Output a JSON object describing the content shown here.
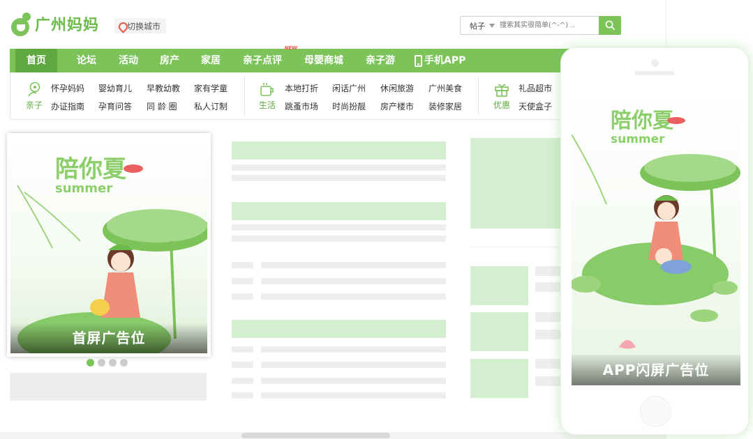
{
  "header": {
    "logo_text": "广州妈妈",
    "city_switch": "切换城市",
    "search_type": "帖子",
    "search_placeholder": "搜索其实很简单(^-^) .."
  },
  "nav": {
    "items": [
      {
        "label": "首页",
        "active": true
      },
      {
        "label": "论坛"
      },
      {
        "label": "活动"
      },
      {
        "label": "房产"
      },
      {
        "label": "家居"
      },
      {
        "label": "亲子点评",
        "badge": "NEW"
      },
      {
        "label": "母婴商城"
      },
      {
        "label": "亲子游"
      },
      {
        "label": "手机APP",
        "icon": "phone-icon"
      }
    ]
  },
  "subnav": {
    "groups": [
      {
        "category": "亲子",
        "icon": "baby-icon",
        "links": [
          "怀孕妈妈",
          "婴幼育儿",
          "早教幼教",
          "家有学童",
          "办证指南",
          "孕育问答",
          "同 龄 圈",
          "私人订制"
        ]
      },
      {
        "category": "生活",
        "icon": "cup-icon",
        "links": [
          "本地打折",
          "闲话广州",
          "休闲旅游",
          "广州美食",
          "跳蚤市场",
          "时尚扮靓",
          "房产楼市",
          "装修家居"
        ]
      },
      {
        "category": "优惠",
        "icon": "gift-icon",
        "links": [
          "礼品超市",
          "天使盒子"
        ]
      }
    ]
  },
  "banner": {
    "art_text": "陪你夏",
    "art_subtext": "summer",
    "caption": "首屏广告位",
    "dots": 4,
    "active_dot": 0
  },
  "phone": {
    "art_text": "陪你夏",
    "art_subtext": "summer",
    "caption": "APP闪屏广告位"
  },
  "colors": {
    "brand_green": "#7cc35a",
    "nav_active": "#5fa940",
    "placeholder_green": "#d4efd0",
    "placeholder_grey": "#eeeeee",
    "badge_red": "#ff5544"
  }
}
